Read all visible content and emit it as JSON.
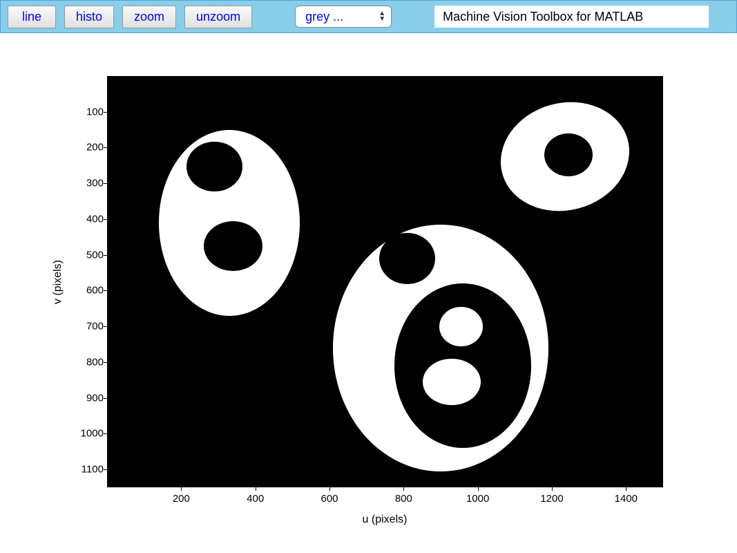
{
  "toolbar": {
    "buttons": {
      "line": "line",
      "histo": "histo",
      "zoom": "zoom",
      "unzoom": "unzoom"
    },
    "colormap_select": "grey ...",
    "title": "Machine Vision Toolbox for MATLAB"
  },
  "axes": {
    "xlabel": "u (pixels)",
    "ylabel": "v (pixels)",
    "xticks": [
      "200",
      "400",
      "600",
      "800",
      "1000",
      "1200",
      "1400"
    ],
    "yticks": [
      "100",
      "200",
      "300",
      "400",
      "500",
      "600",
      "700",
      "800",
      "900",
      "1000",
      "1100"
    ],
    "xlim": [
      0,
      1500
    ],
    "ylim": [
      0,
      1150
    ]
  },
  "blobs": {
    "description": "Binary image with nested ellipse blobs",
    "regions": [
      {
        "id": "big-left-white",
        "cx": 330,
        "cy": 410,
        "rx": 190,
        "ry": 260,
        "color": "white"
      },
      {
        "id": "big-left-hole1",
        "cx": 290,
        "cy": 253,
        "rx": 75,
        "ry": 70,
        "color": "black"
      },
      {
        "id": "big-left-hole2",
        "cx": 340,
        "cy": 475,
        "rx": 80,
        "ry": 70,
        "color": "black"
      },
      {
        "id": "big-center-white",
        "cx": 900,
        "cy": 760,
        "rx": 290,
        "ry": 345,
        "color": "white"
      },
      {
        "id": "center-hole-top",
        "cx": 810,
        "cy": 510,
        "rx": 75,
        "ry": 72,
        "color": "black"
      },
      {
        "id": "center-hole-big",
        "cx": 960,
        "cy": 810,
        "rx": 185,
        "ry": 230,
        "color": "black"
      },
      {
        "id": "center-inner-white1",
        "cx": 955,
        "cy": 700,
        "rx": 58,
        "ry": 55,
        "color": "white"
      },
      {
        "id": "center-inner-white2",
        "cx": 930,
        "cy": 855,
        "rx": 78,
        "ry": 65,
        "color": "white"
      },
      {
        "id": "top-right-white",
        "cx": 1235,
        "cy": 225,
        "rx": 175,
        "ry": 150,
        "rotation": -15,
        "color": "white"
      },
      {
        "id": "top-right-hole",
        "cx": 1245,
        "cy": 220,
        "rx": 65,
        "ry": 60,
        "color": "black"
      }
    ]
  }
}
